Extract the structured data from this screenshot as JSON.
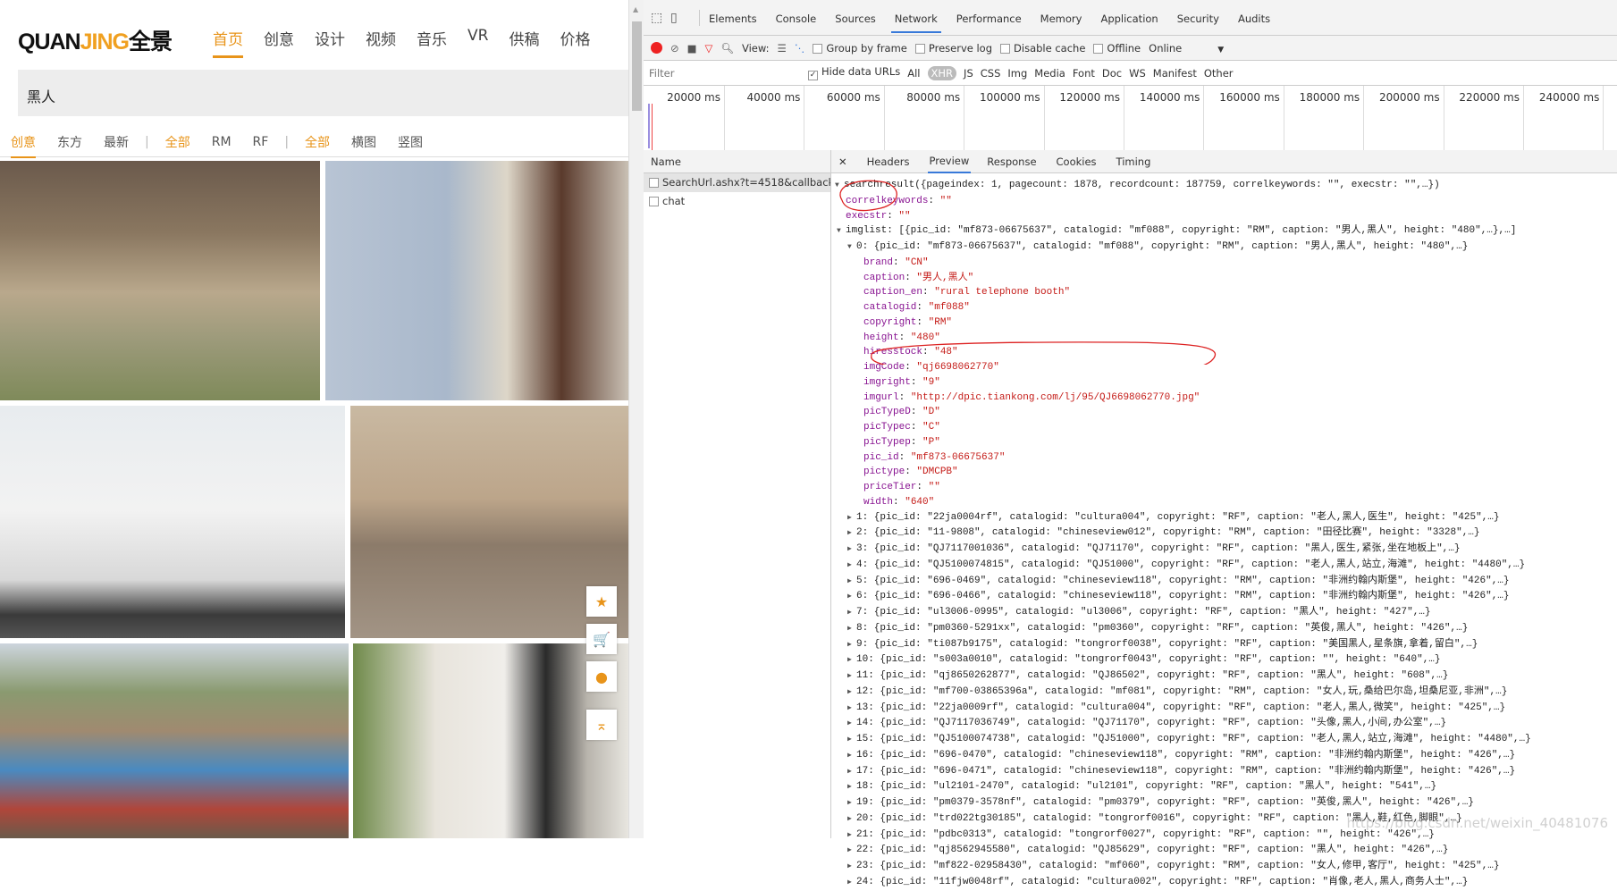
{
  "site": {
    "logo_latin_a": "QUAN",
    "logo_latin_b": "JING",
    "logo_cn": "全景",
    "nav": [
      "首页",
      "创意",
      "设计",
      "视频",
      "音乐",
      "VR",
      "供稿",
      "价格"
    ],
    "search_value": "黑人",
    "filters": [
      "创意",
      "东方",
      "最新",
      "全部",
      "RM",
      "RF",
      "全部",
      "横图",
      "竖图"
    ],
    "accent": "#e8941a",
    "side_buttons": [
      "star-icon",
      "cart-icon",
      "user-icon",
      "back-to-top-icon"
    ]
  },
  "devtools": {
    "tabs": [
      "Elements",
      "Console",
      "Sources",
      "Network",
      "Performance",
      "Memory",
      "Application",
      "Security",
      "Audits"
    ],
    "active_tab": "Network",
    "toolbar": {
      "view": "View:",
      "group_by_frame": "Group by frame",
      "preserve_log": "Preserve log",
      "disable_cache": "Disable cache",
      "offline": "Offline",
      "throttle": "Online"
    },
    "filter_placeholder": "Filter",
    "hide_data_urls": "Hide data URLs",
    "types": [
      "All",
      "XHR",
      "JS",
      "CSS",
      "Img",
      "Media",
      "Font",
      "Doc",
      "WS",
      "Manifest",
      "Other"
    ],
    "active_type": "XHR",
    "timeline_ticks": [
      "20000 ms",
      "40000 ms",
      "60000 ms",
      "80000 ms",
      "100000 ms",
      "120000 ms",
      "140000 ms",
      "160000 ms",
      "180000 ms",
      "200000 ms",
      "220000 ms",
      "240000 ms"
    ],
    "name_header": "Name",
    "requests": [
      "SearchUrl.ashx?t=4518&callback...",
      "chat"
    ],
    "detail_tabs": [
      "Headers",
      "Preview",
      "Response",
      "Cookies",
      "Timing"
    ],
    "active_detail": "Preview",
    "preview": {
      "root": "searchresult({pageindex: 1, pagecount: 1878, recordcount: 187759, correlkeywords: \"\", execstr: \"\",…})",
      "props": [
        {
          "k": "correlkeywords",
          "v": "\"\""
        },
        {
          "k": "execstr",
          "v": "\"\""
        }
      ],
      "imglist": "imglist: [{pic_id: \"mf873-06675637\", catalogid: \"mf088\", copyright: \"RM\", caption: \"男人,黑人\", height: \"480\",…},…]",
      "item0": "0: {pic_id: \"mf873-06675637\", catalogid: \"mf088\", copyright: \"RM\", caption: \"男人,黑人\", height: \"480\",…}",
      "fields": [
        {
          "k": "brand",
          "v": "\"CN\""
        },
        {
          "k": "caption",
          "v": "\"男人,黑人\""
        },
        {
          "k": "caption_en",
          "v": "\"rural telephone booth\""
        },
        {
          "k": "catalogid",
          "v": "\"mf088\""
        },
        {
          "k": "copyright",
          "v": "\"RM\""
        },
        {
          "k": "height",
          "v": "\"480\""
        },
        {
          "k": "hiresstock",
          "v": "\"48\""
        },
        {
          "k": "imgCode",
          "v": "\"qj6698062770\""
        },
        {
          "k": "imgright",
          "v": "\"9\""
        },
        {
          "k": "imgurl",
          "v": "\"http://dpic.tiankong.com/lj/95/QJ6698062770.jpg\""
        },
        {
          "k": "picTypeD",
          "v": "\"D\""
        },
        {
          "k": "picTypec",
          "v": "\"C\""
        },
        {
          "k": "picTypep",
          "v": "\"P\""
        },
        {
          "k": "pic_id",
          "v": "\"mf873-06675637\""
        },
        {
          "k": "pictype",
          "v": "\"DMCPB\""
        },
        {
          "k": "priceTier",
          "v": "\"\""
        },
        {
          "k": "width",
          "v": "\"640\""
        }
      ],
      "items": [
        "1: {pic_id: \"22ja0004rf\", catalogid: \"cultura004\", copyright: \"RF\", caption: \"老人,黑人,医生\", height: \"425\",…}",
        "2: {pic_id: \"11-9808\", catalogid: \"chineseview012\", copyright: \"RM\", caption: \"田径比赛\", height: \"3328\",…}",
        "3: {pic_id: \"QJ7117001036\", catalogid: \"QJ71170\", copyright: \"RF\", caption: \"黑人,医生,紧张,坐在地板上\",…}",
        "4: {pic_id: \"QJ5100074815\", catalogid: \"QJ51000\", copyright: \"RF\", caption: \"老人,黑人,站立,海滩\", height: \"4480\",…}",
        "5: {pic_id: \"696-0469\", catalogid: \"chineseview118\", copyright: \"RM\", caption: \"非洲约翰内斯堡\", height: \"426\",…}",
        "6: {pic_id: \"696-0466\", catalogid: \"chineseview118\", copyright: \"RM\", caption: \"非洲约翰内斯堡\", height: \"426\",…}",
        "7: {pic_id: \"ul3006-0995\", catalogid: \"ul3006\", copyright: \"RF\", caption: \"黑人\", height: \"427\",…}",
        "8: {pic_id: \"pm0360-5291xx\", catalogid: \"pm0360\", copyright: \"RF\", caption: \"英俊,黑人\", height: \"426\",…}",
        "9: {pic_id: \"ti087b9175\", catalogid: \"tongrorf0038\", copyright: \"RF\", caption: \"美国黑人,星条旗,拿着,留白\",…}",
        "10: {pic_id: \"s003a0010\", catalogid: \"tongrorf0043\", copyright: \"RF\", caption: \"\", height: \"640\",…}",
        "11: {pic_id: \"qj8650262877\", catalogid: \"QJ86502\", copyright: \"RF\", caption: \"黑人\", height: \"608\",…}",
        "12: {pic_id: \"mf700-03865396a\", catalogid: \"mf081\", copyright: \"RM\", caption: \"女人,玩,桑给巴尔岛,坦桑尼亚,非洲\",…}",
        "13: {pic_id: \"22ja0009rf\", catalogid: \"cultura004\", copyright: \"RF\", caption: \"老人,黑人,微笑\", height: \"425\",…}",
        "14: {pic_id: \"QJ7117036749\", catalogid: \"QJ71170\", copyright: \"RF\", caption: \"头像,黑人,小间,办公室\",…}",
        "15: {pic_id: \"QJ5100074738\", catalogid: \"QJ51000\", copyright: \"RF\", caption: \"老人,黑人,站立,海滩\", height: \"4480\",…}",
        "16: {pic_id: \"696-0470\", catalogid: \"chineseview118\", copyright: \"RM\", caption: \"非洲约翰内斯堡\", height: \"426\",…}",
        "17: {pic_id: \"696-0471\", catalogid: \"chineseview118\", copyright: \"RM\", caption: \"非洲约翰内斯堡\", height: \"426\",…}",
        "18: {pic_id: \"ul2101-2470\", catalogid: \"ul2101\", copyright: \"RF\", caption: \"黑人\", height: \"541\",…}",
        "19: {pic_id: \"pm0379-3578nf\", catalogid: \"pm0379\", copyright: \"RF\", caption: \"英俊,黑人\", height: \"426\",…}",
        "20: {pic_id: \"trd022tg30185\", catalogid: \"tongrorf0016\", copyright: \"RF\", caption: \"黑人,鞋,红色,脚眼\",…}",
        "21: {pic_id: \"pdbc0313\", catalogid: \"tongrorf0027\", copyright: \"RF\", caption: \"\", height: \"426\",…}",
        "22: {pic_id: \"qj8562945580\", catalogid: \"QJ85629\", copyright: \"RF\", caption: \"黑人\", height: \"426\",…}",
        "23: {pic_id: \"mf822-02958430\", catalogid: \"mf060\", copyright: \"RM\", caption: \"女人,修甲,客厅\", height: \"425\",…}",
        "24: {pic_id: \"11fjw0048rf\", catalogid: \"cultura002\", copyright: \"RF\", caption: \"肖像,老人,黑人,商务人士\",…}"
      ]
    },
    "watermark": "https://blog.csdn.net/weixin_40481076"
  }
}
